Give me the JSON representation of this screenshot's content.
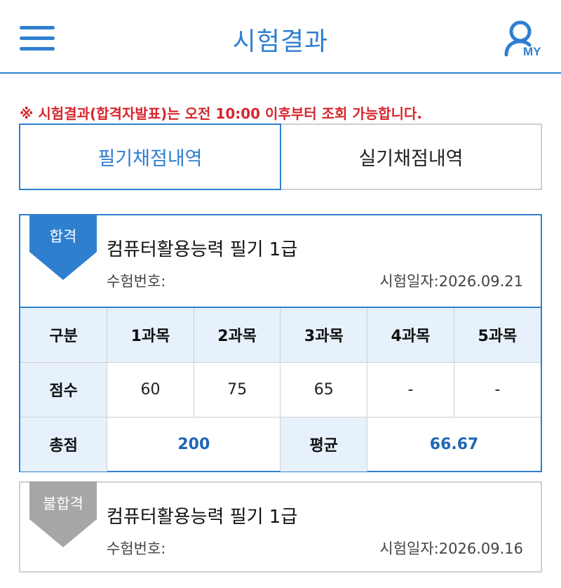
{
  "header": {
    "title": "시험결과",
    "menu_icon": "hamburger-menu-icon",
    "my_icon": "user-icon",
    "my_label": "MY"
  },
  "notice": {
    "text": "※ 시험결과(합격자발표)는 오전 10:00 이후부터 조회 가능합니다.",
    "color": "#d7262e"
  },
  "tabs": [
    {
      "label": "필기채점내역",
      "active": true
    },
    {
      "label": "실기채점내역",
      "active": false
    }
  ],
  "results": [
    {
      "status": "합격",
      "status_color": "#2f7fd0",
      "exam_name": "컴퓨터활용능력 필기 1급",
      "exam_no_label": "수험번호:",
      "exam_date_label": "시험일자:2026.09.21",
      "table": {
        "header": [
          "구분",
          "1과목",
          "2과목",
          "3과목",
          "4과목",
          "5과목"
        ],
        "score_label": "점수",
        "scores": [
          "60",
          "75",
          "65",
          "-",
          "-"
        ],
        "total_label": "총점",
        "total": "200",
        "avg_label": "평균",
        "avg": "66.67"
      }
    },
    {
      "status": "불합격",
      "status_color": "#a6a6a6",
      "exam_name": "컴퓨터활용능력 필기 1급",
      "exam_no_label": "수험번호:",
      "exam_date_label": "시험일자:2026.09.16"
    }
  ],
  "colors": {
    "accent": "#2f7fd0",
    "table_header_bg": "#e6f1fb",
    "border": "#cfcfcf"
  }
}
